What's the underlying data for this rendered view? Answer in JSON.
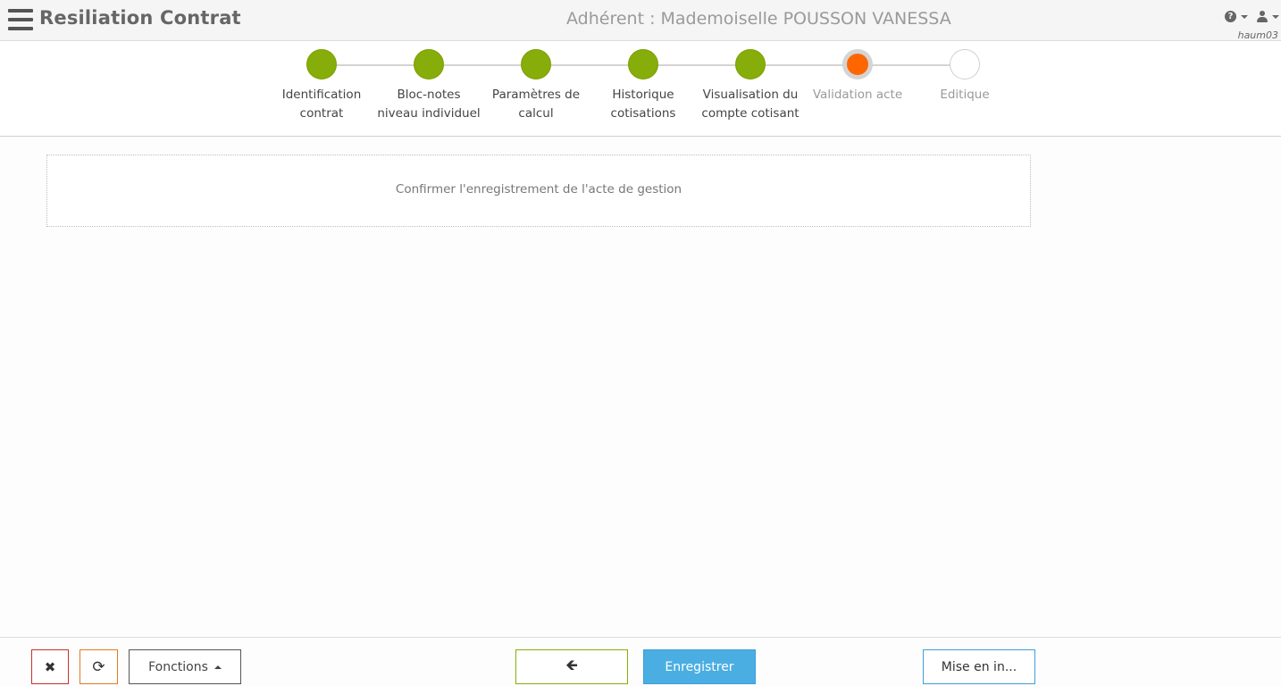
{
  "header": {
    "title": "Resiliation Contrat",
    "member": "Adhérent : Mademoiselle POUSSON VANESSA",
    "username": "haum03",
    "help_icon": "?"
  },
  "stepper": {
    "steps": [
      {
        "line1": "Identification",
        "line2": "contrat",
        "state": "done"
      },
      {
        "line1": "Bloc-notes",
        "line2": "niveau individuel",
        "state": "done"
      },
      {
        "line1": "Paramètres de",
        "line2": "calcul",
        "state": "done"
      },
      {
        "line1": "Historique",
        "line2": "cotisations",
        "state": "done"
      },
      {
        "line1": "Visualisation du",
        "line2": "compte cotisant",
        "state": "done"
      },
      {
        "line1": "Validation acte",
        "line2": "",
        "state": "current"
      },
      {
        "line1": "Editique",
        "line2": "",
        "state": "todo"
      }
    ],
    "colors": {
      "done": "#86ad0a",
      "current": "#ff6600",
      "todo": "#ffffff"
    }
  },
  "main": {
    "confirm_message": "Confirmer l'enregistrement de l'acte de gestion"
  },
  "footer": {
    "close_icon": "✖",
    "refresh_icon": "⟳",
    "fonctions_label": "Fonctions",
    "back_icon": "🡸",
    "save_label": "Enregistrer",
    "mise_label": "Mise en in..."
  }
}
